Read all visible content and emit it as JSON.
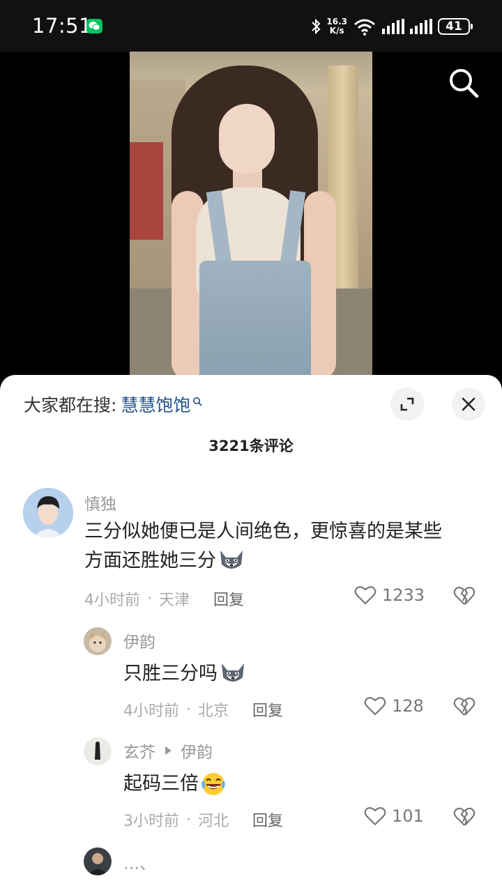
{
  "status_bar": {
    "time": "17:51",
    "net_speed_value": "16.3",
    "net_speed_unit": "K/s",
    "net_sup": "6",
    "battery": "41",
    "icons": [
      "wechat-icon",
      "bluetooth-icon",
      "wifi-icon",
      "signal-icon",
      "signal-icon",
      "battery-icon"
    ]
  },
  "video": {
    "search_icon": "search-icon"
  },
  "sheet": {
    "suggest_label": "大家都在搜:",
    "suggest_link": "慧慧饱饱",
    "comment_count": "3221条评论",
    "comments": [
      {
        "user": "慎独",
        "text_line1": "三分似她便已是人间绝色，更惊喜的是某些",
        "text_line2": "方面还胜她三分",
        "emoji": "husky-emoji",
        "time": "4小时前",
        "location": "天津",
        "reply": "回复",
        "likes": "1233"
      },
      {
        "user": "伊韵",
        "text": "只胜三分吗",
        "emoji": "husky-emoji",
        "time": "4小时前",
        "location": "北京",
        "reply": "回复",
        "likes": "128"
      },
      {
        "user": "玄芥",
        "reply_to": "伊韵",
        "text": "起码三倍",
        "emoji": "laughing-emoji",
        "time": "3小时前",
        "location": "河北",
        "reply": "回复",
        "likes": "101"
      },
      {
        "user": "…、"
      }
    ],
    "separator": "·"
  }
}
